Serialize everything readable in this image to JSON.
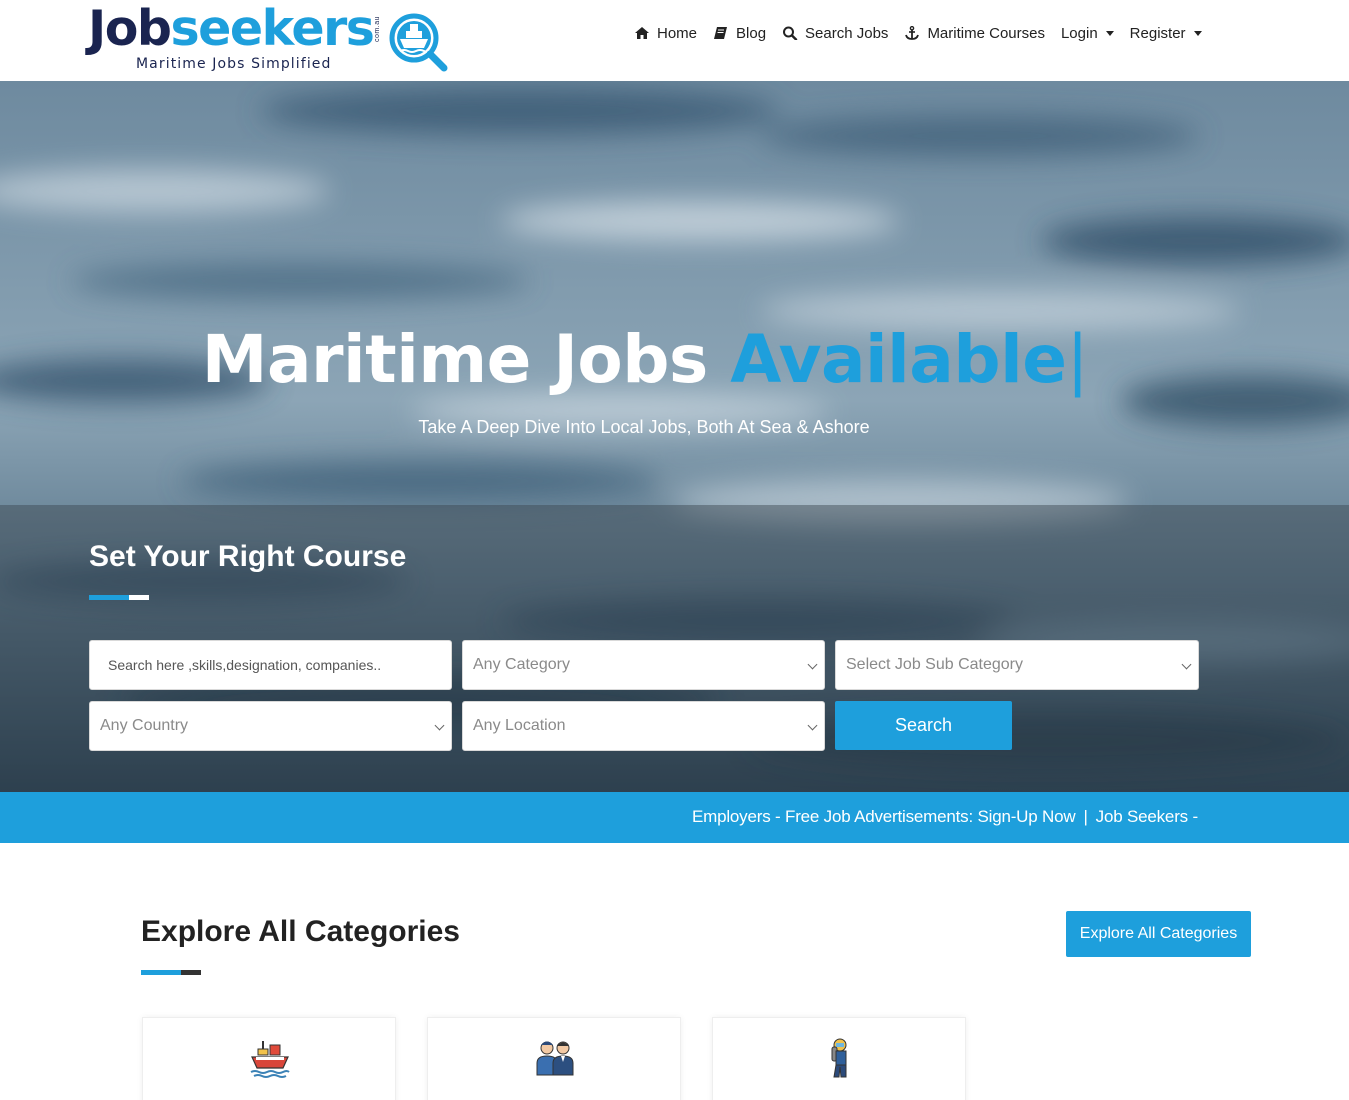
{
  "brand": {
    "word_part1": "Job",
    "word_part2": "seekers",
    "domain": "com.au",
    "tagline": "Maritime Jobs Simplified"
  },
  "nav": {
    "items": [
      {
        "label": "Home",
        "icon": "home-icon"
      },
      {
        "label": "Blog",
        "icon": "book-icon"
      },
      {
        "label": "Search Jobs",
        "icon": "search-icon"
      },
      {
        "label": "Maritime Courses",
        "icon": "anchor-icon"
      },
      {
        "label": "Login",
        "icon": "dropdown-caret"
      },
      {
        "label": "Register",
        "icon": "dropdown-caret"
      }
    ]
  },
  "hero": {
    "title_main": "Maritime Jobs",
    "title_accent": "Available",
    "title_cursor": "|",
    "subtitle": "Take A Deep Dive Into Local Jobs, Both At Sea & Ashore"
  },
  "search": {
    "heading": "Set Your Right Course",
    "keyword_placeholder": "Search here ,skills,designation, companies..",
    "category_value": "Any Category",
    "subcategory_value": "Select Job Sub Category",
    "country_value": "Any Country",
    "location_value": "Any Location",
    "button_label": "Search"
  },
  "ticker": {
    "item1": "Employers - Free Job Advertisements: Sign-Up Now",
    "separator": "|",
    "item2": "Job Seekers - F"
  },
  "categories": {
    "heading": "Explore All Categories",
    "button_label": "Explore All Categories",
    "cards": [
      {
        "icon": "ship-icon"
      },
      {
        "icon": "crew-icon"
      },
      {
        "icon": "diver-icon"
      }
    ]
  },
  "colors": {
    "accent": "#1e9fdc",
    "navy": "#1a2450",
    "text": "#222222"
  }
}
